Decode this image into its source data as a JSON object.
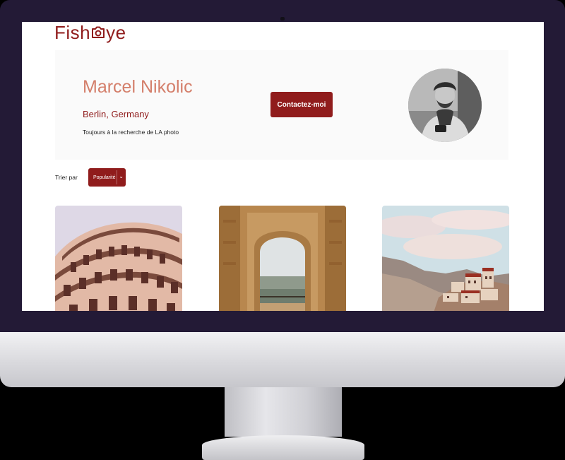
{
  "header": {
    "logo_text_before": "Fish",
    "logo_text_after": "ye"
  },
  "profile": {
    "name": "Marcel Nikolic",
    "location": "Berlin, Germany",
    "tagline": "Toujours à la recherche de LA photo",
    "contact_label": "Contactez-moi"
  },
  "sort": {
    "label": "Trier par",
    "selected": "Popularité"
  },
  "gallery": [
    {
      "subject": "leaning-tower-photo"
    },
    {
      "subject": "moorish-arch-window-photo"
    },
    {
      "subject": "mountain-monastery-photo"
    }
  ],
  "colors": {
    "brand": "#901c1c",
    "name_accent": "#d47f6b",
    "header_bg": "#fafafa",
    "monitor_bezel": "#231a36"
  }
}
